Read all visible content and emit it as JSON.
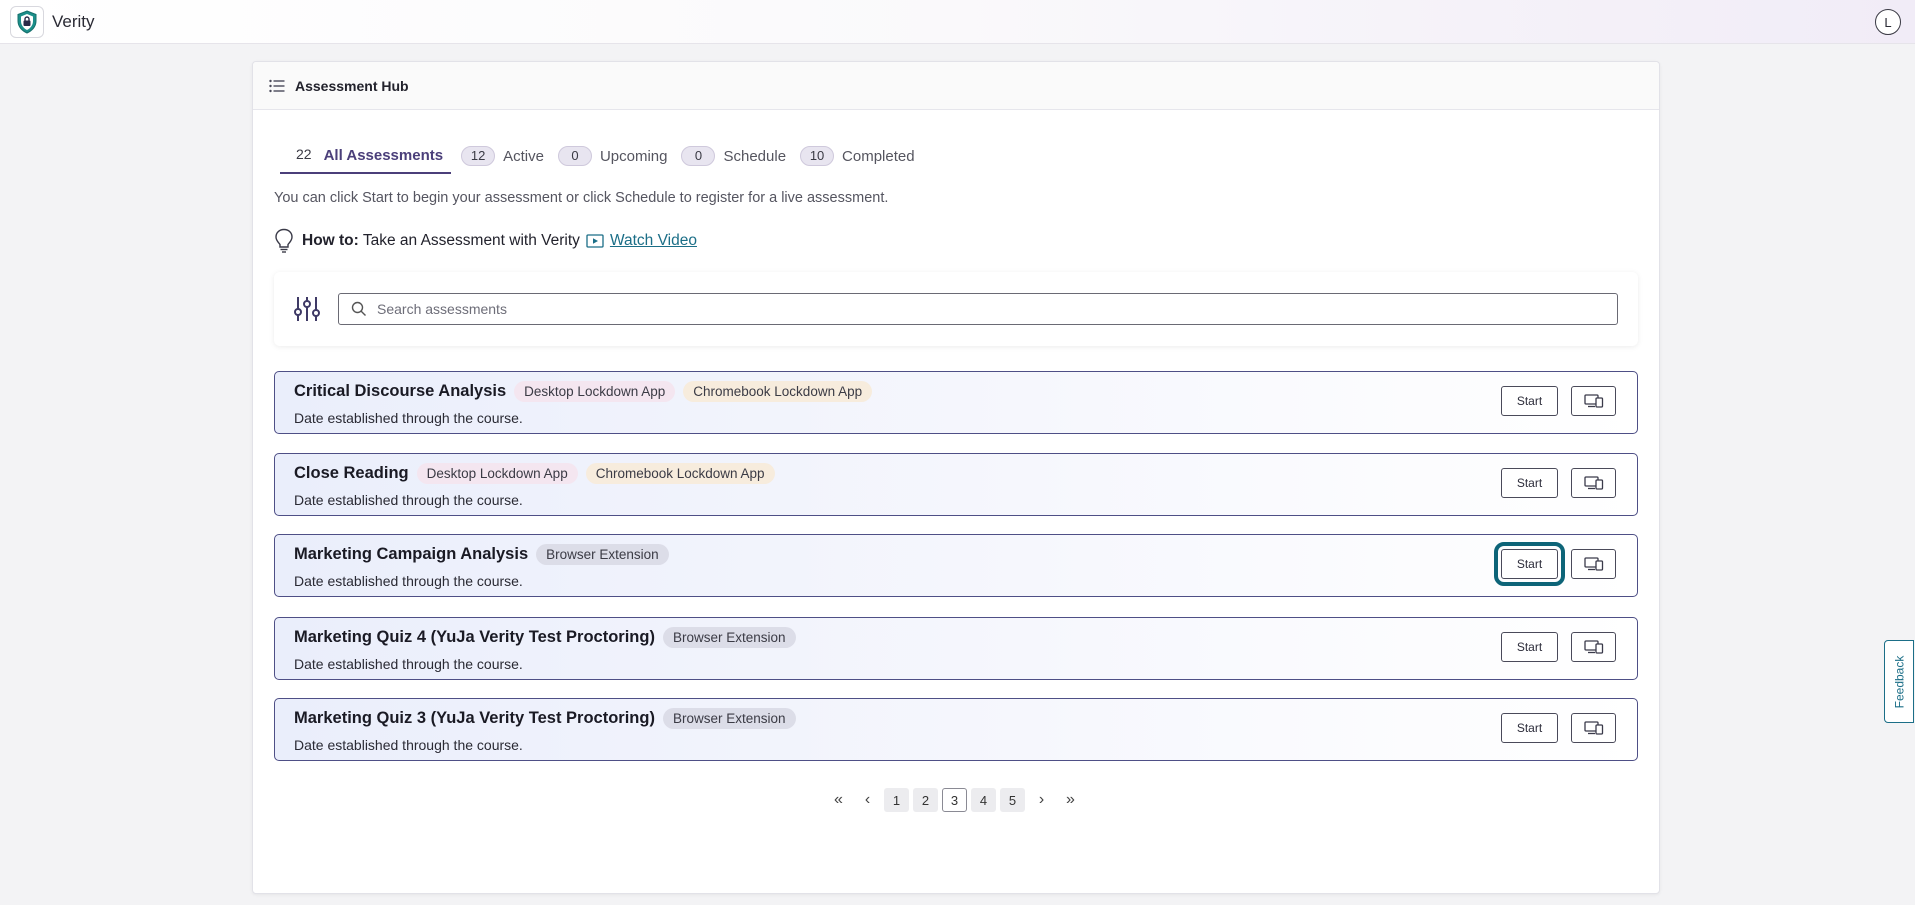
{
  "app": {
    "title": "Verity",
    "user_initial": "L"
  },
  "hub": {
    "title": "Assessment Hub",
    "tabs": [
      {
        "count": "22",
        "label": "All Assessments",
        "active": true
      },
      {
        "count": "12",
        "label": "Active"
      },
      {
        "count": "0",
        "label": "Upcoming"
      },
      {
        "count": "0",
        "label": "Schedule"
      },
      {
        "count": "10",
        "label": "Completed"
      }
    ],
    "instructions": "You can click Start to begin your assessment or click Schedule to register for a live assessment.",
    "howto_bold": "How to:",
    "howto_text": "Take an Assessment with Verity",
    "watch_video": "Watch Video"
  },
  "search": {
    "placeholder": "Search assessments"
  },
  "assessments": [
    {
      "name": "Critical Discourse Analysis",
      "badges": [
        "Desktop Lockdown App",
        "Chromebook Lockdown App"
      ],
      "date": "Date established through the course.",
      "start": "Start"
    },
    {
      "name": "Close Reading",
      "badges": [
        "Desktop Lockdown App",
        "Chromebook Lockdown App"
      ],
      "date": "Date established through the course.",
      "start": "Start"
    },
    {
      "name": "Marketing Campaign Analysis",
      "badges": [
        "Browser Extension"
      ],
      "date": "Date established through the course.",
      "start": "Start"
    },
    {
      "name": "Marketing Quiz 4 (YuJa Verity Test Proctoring)",
      "badges": [
        "Browser Extension"
      ],
      "date": "Date established through the course.",
      "start": "Start"
    },
    {
      "name": "Marketing Quiz 3 (YuJa Verity Test Proctoring)",
      "badges": [
        "Browser Extension"
      ],
      "date": "Date established through the course.",
      "start": "Start"
    }
  ],
  "pagination": {
    "first": "«",
    "prev": "‹",
    "pages": [
      "1",
      "2",
      "3",
      "4",
      "5"
    ],
    "current": "3",
    "next": "›",
    "last": "»"
  },
  "feedback": "Feedback",
  "colors": {
    "accent": "#4b3f7a",
    "link": "#1b6e87",
    "focus_ring": "#0d6478"
  }
}
